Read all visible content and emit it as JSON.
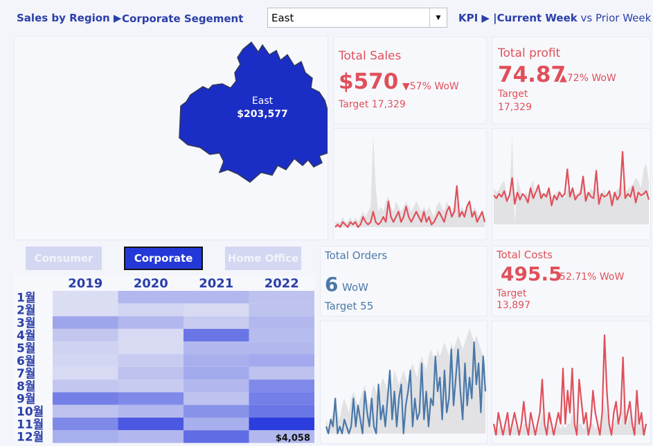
{
  "header": {
    "sales_by_region": "Sales by Region ▶",
    "segment_title": "Corporate Segement",
    "region_select": "East",
    "kpi_prefix": "KPI ▶ |",
    "kpi_current": "Current Week",
    "kpi_vs": " vs Prior Week"
  },
  "map": {
    "region_label": "East",
    "region_value": "$203,577",
    "region_color": "#1a2dc4"
  },
  "kpis": {
    "sales": {
      "title": "Total Sales",
      "value": "$570",
      "delta": "▼57% WoW",
      "target": "Target 17,329"
    },
    "profit": {
      "title": "Total profit",
      "value": "74.87",
      "delta": "▲72%  WoW",
      "target_label": "Target",
      "target_value": "17,329"
    },
    "orders": {
      "title": "Total Orders",
      "value": "6",
      "delta": "WoW",
      "target": "Target 55"
    },
    "costs": {
      "title": "Total Costs",
      "value": "495.5",
      "delta": "-52.71% WoW",
      "target_label": "Target",
      "target_value": "13,897"
    }
  },
  "segments": {
    "consumer": "Consumer",
    "corporate": "Corporate",
    "home_office": "Home Office",
    "selected": "Corporate"
  },
  "colors": {
    "accent": "#2b3fa8",
    "red": "#e0505a",
    "steel": "#4a78a8",
    "heat_max": "#2233dd"
  },
  "chart_data": [
    {
      "type": "heatmap",
      "title": "",
      "x": [
        "2019",
        "2020",
        "2021",
        "2022"
      ],
      "y": [
        "1월",
        "2월",
        "3월",
        "4월",
        "5월",
        "6월",
        "7월",
        "8월",
        "9월",
        "10월",
        "11월",
        "12월"
      ],
      "values": [
        [
          0.1,
          0.3,
          0.3,
          0.25
        ],
        [
          0.1,
          0.15,
          0.12,
          0.25
        ],
        [
          0.4,
          0.3,
          0.2,
          0.3
        ],
        [
          0.22,
          0.12,
          0.65,
          0.28
        ],
        [
          0.16,
          0.12,
          0.3,
          0.3
        ],
        [
          0.14,
          0.2,
          0.35,
          0.38
        ],
        [
          0.12,
          0.25,
          0.38,
          0.25
        ],
        [
          0.22,
          0.2,
          0.3,
          0.55
        ],
        [
          0.6,
          0.55,
          0.25,
          0.6
        ],
        [
          0.25,
          0.3,
          0.5,
          0.65
        ],
        [
          0.55,
          0.8,
          0.35,
          0.95
        ],
        [
          0.35,
          0.3,
          0.7,
          0.3
        ]
      ],
      "annotation": "$4,058"
    },
    {
      "type": "line",
      "name": "sales",
      "values": [
        4,
        4.5,
        4,
        5,
        4.5,
        4,
        5,
        4.5,
        5,
        4,
        4.5,
        6,
        5,
        4.5,
        5,
        7,
        5,
        4.5,
        5,
        6,
        5,
        9,
        6,
        5,
        6,
        7,
        5,
        6,
        8,
        6,
        5,
        6,
        7,
        6,
        5,
        7,
        5,
        6,
        4.5,
        5,
        6,
        7,
        6,
        5,
        7,
        8,
        6,
        7,
        12,
        6,
        7,
        6,
        8,
        9,
        6,
        7,
        5,
        6,
        7,
        5
      ],
      "background_values": [
        5,
        5,
        5,
        6,
        5,
        5,
        6,
        5,
        6,
        5,
        6,
        7,
        6,
        7,
        8,
        22,
        12,
        7,
        8,
        7,
        9,
        10,
        8,
        7,
        9,
        8,
        7,
        8,
        9,
        8,
        7,
        8,
        9,
        8,
        7,
        8,
        7,
        8,
        7,
        6,
        8,
        9,
        8,
        7,
        9,
        8,
        7,
        8,
        9,
        7,
        8,
        7,
        8,
        9,
        7,
        8,
        7,
        6,
        7,
        6
      ]
    },
    {
      "type": "line",
      "name": "profit",
      "values": [
        50,
        48,
        51,
        49,
        53,
        46,
        50,
        62,
        44,
        52,
        47,
        51,
        49,
        45,
        55,
        48,
        52,
        57,
        48,
        51,
        49,
        55,
        43,
        50,
        47,
        52,
        49,
        51,
        68,
        49,
        55,
        47,
        50,
        51,
        63,
        46,
        52,
        49,
        48,
        67,
        44,
        51,
        49,
        50,
        53,
        43,
        52,
        47,
        50,
        80,
        48,
        51,
        49,
        56,
        45,
        52,
        50,
        51,
        53,
        47
      ],
      "background_values": [
        55,
        52,
        54,
        58,
        60,
        50,
        45,
        92,
        30,
        62,
        55,
        48,
        52,
        50,
        57,
        60,
        48,
        56,
        53,
        50,
        52,
        55,
        48,
        50,
        52,
        54,
        50,
        48,
        55,
        52,
        54,
        50,
        52,
        53,
        58,
        52,
        50,
        55,
        52,
        56,
        50,
        52,
        54,
        50,
        53,
        50,
        52,
        54,
        55,
        58,
        52,
        54,
        56,
        58,
        62,
        60,
        55,
        68,
        72,
        60
      ]
    },
    {
      "type": "line",
      "name": "orders",
      "values": [
        2,
        1,
        3,
        2,
        6,
        1,
        2,
        1,
        3,
        2,
        1,
        2,
        6,
        2,
        5,
        3,
        1,
        7,
        4,
        2,
        6,
        2,
        1,
        8,
        3,
        5,
        2,
        6,
        10,
        3,
        7,
        2,
        6,
        8,
        1,
        5,
        7,
        10,
        2,
        6,
        3,
        4,
        11,
        3,
        7,
        2,
        6,
        5,
        12,
        7,
        9,
        3,
        10,
        4,
        6,
        13,
        5,
        9,
        13,
        7,
        3,
        11,
        5,
        9,
        6,
        14,
        8,
        11,
        4,
        12,
        7
      ],
      "background_values": [
        3,
        2,
        3,
        4,
        5,
        4,
        3,
        5,
        6,
        5,
        4,
        6,
        7,
        6,
        5,
        6,
        7,
        8,
        6,
        5,
        7,
        8,
        7,
        6,
        8,
        9,
        8,
        7,
        9,
        8,
        10,
        9,
        8,
        9,
        10,
        9,
        8,
        10,
        11,
        10,
        9,
        11,
        12,
        11,
        10,
        12,
        13,
        12,
        11,
        13,
        12,
        13,
        14,
        13,
        12,
        14,
        13,
        14,
        15,
        14,
        13,
        14,
        15,
        16,
        15,
        14,
        15,
        14,
        13,
        12,
        11
      ]
    },
    {
      "type": "line",
      "name": "costs",
      "values": [
        2,
        1,
        3,
        2,
        1,
        2,
        3,
        1,
        2,
        3,
        2,
        1,
        2,
        4,
        2,
        1,
        3,
        2,
        1,
        2,
        3,
        6,
        2,
        1,
        3,
        2,
        1,
        2,
        3,
        2,
        7,
        2,
        5,
        3,
        7,
        2,
        1,
        6,
        4,
        2,
        3,
        1,
        2,
        5,
        3,
        2,
        1,
        3,
        10,
        5,
        2,
        1,
        3,
        4,
        2,
        3,
        8,
        2,
        3,
        4,
        2,
        1,
        5,
        2,
        3,
        1,
        2
      ],
      "background_values": [
        1.5,
        1,
        1.5,
        2,
        1,
        1.5,
        2,
        1,
        1.5,
        2,
        1.5,
        1,
        1.5,
        2,
        2,
        1.5,
        2,
        1.5,
        1,
        1.5,
        2,
        3,
        2,
        1.5,
        2,
        1.5,
        1,
        1.5,
        2,
        1.5,
        2,
        1.5,
        2,
        2,
        3,
        2,
        1.5,
        2,
        2,
        1.5,
        2,
        1.5,
        2,
        2,
        1.5,
        2,
        1.5,
        2,
        4,
        3,
        2,
        1.5,
        2,
        2.5,
        2,
        2,
        4,
        2,
        2,
        3,
        2,
        1.5,
        3,
        2,
        2,
        1.5,
        2
      ]
    }
  ]
}
